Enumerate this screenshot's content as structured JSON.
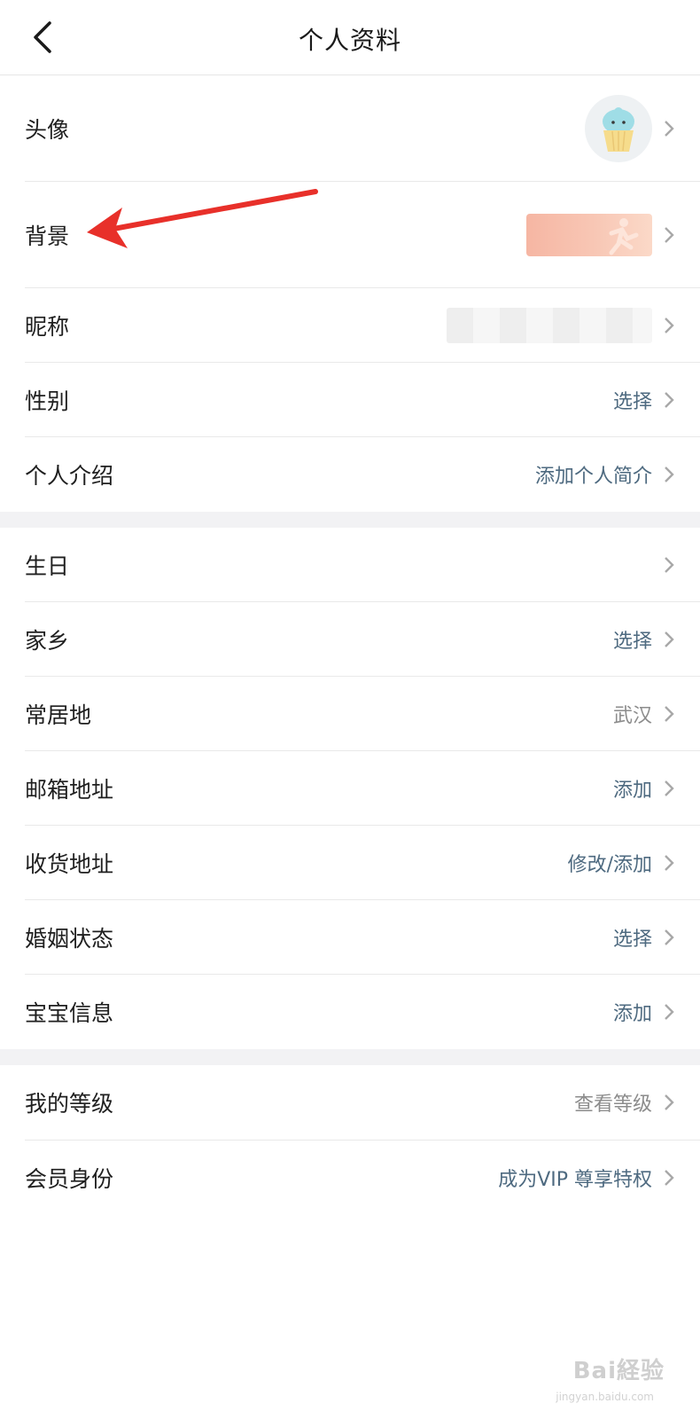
{
  "header": {
    "title": "个人资料",
    "back_icon": "chevron-left-icon"
  },
  "section1": {
    "avatar_label": "头像",
    "background_label": "背景",
    "nickname_label": "昵称",
    "gender_label": "性别",
    "gender_value": "选择",
    "intro_label": "个人介绍",
    "intro_value": "添加个人简介"
  },
  "section2": {
    "birthday_label": "生日",
    "hometown_label": "家乡",
    "hometown_value": "选择",
    "residence_label": "常居地",
    "residence_value": "武汉",
    "email_label": "邮箱地址",
    "email_value": "添加",
    "shipping_label": "收货地址",
    "shipping_value": "修改/添加",
    "marital_label": "婚姻状态",
    "marital_value": "选择",
    "baby_label": "宝宝信息",
    "baby_value": "添加"
  },
  "section3": {
    "level_label": "我的等级",
    "level_value": "查看等级",
    "member_label": "会员身份",
    "member_value": "成为VIP 尊享特权"
  },
  "watermark": {
    "brand": "Bai経验",
    "url": "jingyan.baidu.com"
  },
  "colors": {
    "link_value": "#4e6a80",
    "muted_value": "#8c8c8c",
    "annotation_arrow": "#e8302a",
    "divider": "#e9e9e9",
    "section_gap": "#f2f2f4"
  }
}
